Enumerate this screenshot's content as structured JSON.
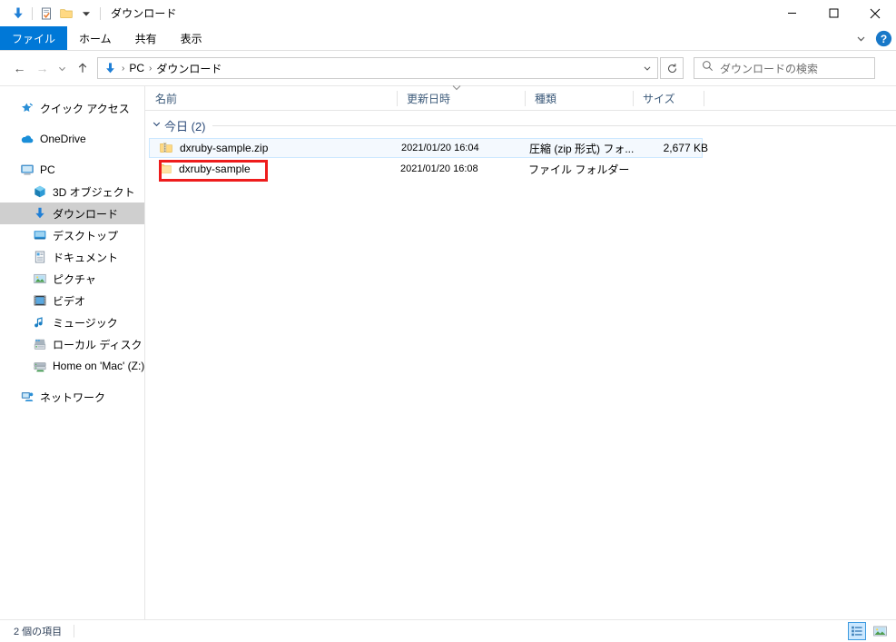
{
  "window": {
    "title": "ダウンロード",
    "quick_access_icons": [
      "download-arrow-icon",
      "properties-icon",
      "new-folder-icon",
      "customize-chevron-icon"
    ],
    "controls": {
      "minimize": "minimize-icon",
      "maximize": "maximize-icon",
      "close": "close-icon"
    }
  },
  "ribbon": {
    "tabs": [
      {
        "label": "ファイル",
        "active": true
      },
      {
        "label": "ホーム",
        "active": false
      },
      {
        "label": "共有",
        "active": false
      },
      {
        "label": "表示",
        "active": false
      }
    ],
    "expand_label": "chevron-down-icon",
    "help_label": "?"
  },
  "addressbar": {
    "back": "←",
    "forward": "→",
    "recent": "⌄",
    "up": "↑",
    "crumbs": [
      "PC",
      "ダウンロード"
    ],
    "crumb_separator": "›",
    "dropdown_caret": "⌄",
    "refresh": "refresh-icon"
  },
  "search": {
    "placeholder": "ダウンロードの検索",
    "icon": "search-icon"
  },
  "sidebar": {
    "items": [
      {
        "label": "クイック アクセス",
        "icon": "star-pin-icon",
        "level": 0,
        "selected": false
      },
      {
        "label": "OneDrive",
        "icon": "cloud-icon",
        "level": 0,
        "selected": false
      },
      {
        "label": "PC",
        "icon": "monitor-icon",
        "level": 0,
        "selected": false
      },
      {
        "label": "3D オブジェクト",
        "icon": "cube-icon",
        "level": 2,
        "selected": false
      },
      {
        "label": "ダウンロード",
        "icon": "download-arrow-icon",
        "level": 2,
        "selected": true
      },
      {
        "label": "デスクトップ",
        "icon": "desktop-icon",
        "level": 2,
        "selected": false
      },
      {
        "label": "ドキュメント",
        "icon": "document-icon",
        "level": 2,
        "selected": false
      },
      {
        "label": "ピクチャ",
        "icon": "picture-icon",
        "level": 2,
        "selected": false
      },
      {
        "label": "ビデオ",
        "icon": "video-icon",
        "level": 2,
        "selected": false
      },
      {
        "label": "ミュージック",
        "icon": "music-note-icon",
        "level": 2,
        "selected": false
      },
      {
        "label": "ローカル ディスク (C:)",
        "icon": "hard-disk-icon",
        "level": 2,
        "selected": false
      },
      {
        "label": "Home on 'Mac' (Z:)",
        "icon": "network-drive-icon",
        "level": 2,
        "selected": false
      },
      {
        "label": "ネットワーク",
        "icon": "network-icon",
        "level": 0,
        "selected": false
      }
    ]
  },
  "filelist": {
    "columns": [
      {
        "label": "名前",
        "sorted": false
      },
      {
        "label": "更新日時",
        "sorted": true
      },
      {
        "label": "種類",
        "sorted": false
      },
      {
        "label": "サイズ",
        "sorted": false
      }
    ],
    "group": {
      "label": "今日 (2)",
      "chevron": "⌄"
    },
    "rows": [
      {
        "name": "dxruby-sample.zip",
        "date": "2021/01/20 16:04",
        "type": "圧縮 (zip 形式) フォ...",
        "size": "2,677 KB",
        "icon": "zip-folder-icon",
        "selected": true,
        "annotated": false
      },
      {
        "name": "dxruby-sample",
        "date": "2021/01/20 16:08",
        "type": "ファイル フォルダー",
        "size": "",
        "icon": "folder-icon",
        "selected": false,
        "annotated": true
      }
    ]
  },
  "statusbar": {
    "item_count": "2 個の項目",
    "views": [
      {
        "name": "details-view",
        "active": true
      },
      {
        "name": "large-icons-view",
        "active": false
      }
    ]
  },
  "colors": {
    "accent": "#0078d7",
    "annotation": "#ee1c1c",
    "selection": "#cce8ff",
    "folder_yellow": "#ffd983",
    "header_text": "#3c5a7a"
  }
}
